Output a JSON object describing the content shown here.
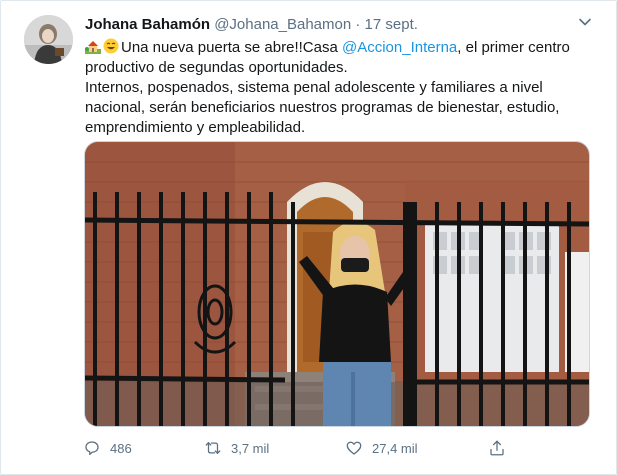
{
  "tweet": {
    "author_name": "Johana Bahamón",
    "author_handle": "@Johana_Bahamon",
    "separator": "·",
    "date": "17 sept.",
    "text_intro": "Una nueva puerta se abre!!Casa ",
    "mention": "@Accion_Interna",
    "text_after_mention": ", el primer centro productivo de segundas oportunidades.",
    "text_paragraph2": "Internos, pospenados, sistema penal adolescente y familiares a nivel nacional, serán beneficiarios nuestros programas de bienestar, estudio, emprendimiento y empleabilidad.",
    "emojis": [
      "house-with-garden-icon",
      "smiling-face-icon"
    ]
  },
  "actions": {
    "reply_count": "486",
    "retweet_count": "3,7 mil",
    "like_count": "27,4 mil"
  },
  "colors": {
    "accent": "#1b95e0",
    "secondary_text": "#5b7083",
    "border": "#e1e8ed"
  }
}
